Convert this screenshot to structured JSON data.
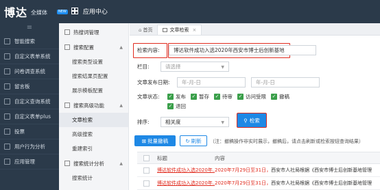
{
  "header": {
    "logo": "博达",
    "logo_sub": "全媒体",
    "logo_badge": "NEW",
    "app_center": "应用中心"
  },
  "sidebar": {
    "toggle": "≡",
    "items": [
      {
        "label": "智能搜索"
      },
      {
        "label": "自定义表单系统"
      },
      {
        "label": "问卷调查系统"
      },
      {
        "label": "留言板"
      },
      {
        "label": "自定义查询系统"
      },
      {
        "label": "自定义表单plus"
      },
      {
        "label": "投票"
      },
      {
        "label": "用户行为分析"
      },
      {
        "label": "应用管理"
      }
    ]
  },
  "submenu": {
    "hot_words": "热搜词管理",
    "search_config": "搜索配置",
    "search_type": "搜索类型设置",
    "result_page": "搜索结果页配置",
    "display_template": "展示模板配置",
    "advanced": "搜索高级功能",
    "doc_search": "文章检索",
    "advanced_search": "高级搜索",
    "rebuild_index": "重建索引",
    "stats": "搜索统计分析",
    "stats_sub": "搜索统计"
  },
  "tabs": {
    "home": "首页",
    "active": "文章检索",
    "close": "×"
  },
  "form": {
    "search_label": "检索内容:",
    "search_value": "博达软件成功入选2020年西安市博士后创新基地",
    "column_label": "栏目:",
    "column_placeholder": "请选择",
    "date_label": "文章发布日期:",
    "date_from_placeholder": "年-月-日",
    "date_to_placeholder": "年-月-日",
    "status_label": "文章状态:",
    "statuses": [
      "发布",
      "暂存",
      "待审",
      "访问受限",
      "撤稿",
      "退回"
    ],
    "sort_label": "排序:",
    "sort_value": "相关度",
    "search_button": "检索"
  },
  "toolbar": {
    "batch_withdraw": "批量撤稿",
    "refresh": "刷新",
    "note": "（注：撤稿操作非实时展示，撤稿后，请点击刷新或检索按钮查询结果）"
  },
  "table": {
    "headers": [
      "标题",
      "内容"
    ],
    "rows": [
      {
        "title": "博达软件成功入选2020年...",
        "content_a": "2020年7月29日至31日，",
        "content_b": "西安市人社局根据《西安市博士后创新基地管理"
      },
      {
        "title": "博达软件成功入选2020年...",
        "content_a": "2020年7月29日至31日，",
        "content_b": "西安市人社局根据《西安市博士后创新基地管理"
      }
    ]
  },
  "colors": {
    "accent": "#1e88e5",
    "highlight": "#e02a1d",
    "check": "#3a9f4a",
    "sidebar_bg": "#2b3a4a"
  }
}
